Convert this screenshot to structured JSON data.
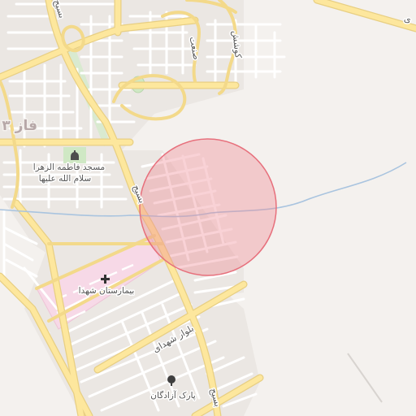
{
  "map": {
    "district_label": "فاز ۳",
    "roads": {
      "basij": "بسیج",
      "basij_top": "بسیج",
      "basij_bottom": "بسیج",
      "shohada_blvd": "بلوار شهدای",
      "sanat": "صنعت",
      "kooshesh": "کوشش",
      "top_fragment": "ی"
    },
    "pois": {
      "mosque_line1": "مسجد فاطمه الزهرا",
      "mosque_line2": "سلام الله علیها",
      "hospital": "بیمارستان شهدا",
      "park": "پارک آزادگان"
    },
    "icons": {
      "mosque": "mosque-icon",
      "hospital": "hospital-cross-icon",
      "park": "tree-icon"
    },
    "colors": {
      "background": "#f4f1ee",
      "road_major": "#fde79d",
      "road_minor": "#ffffff",
      "hospital_area": "#f7d9e7",
      "park_area": "#cfe8c4",
      "river": "#a9c4df",
      "highlight_circle": "#f08a94"
    }
  }
}
